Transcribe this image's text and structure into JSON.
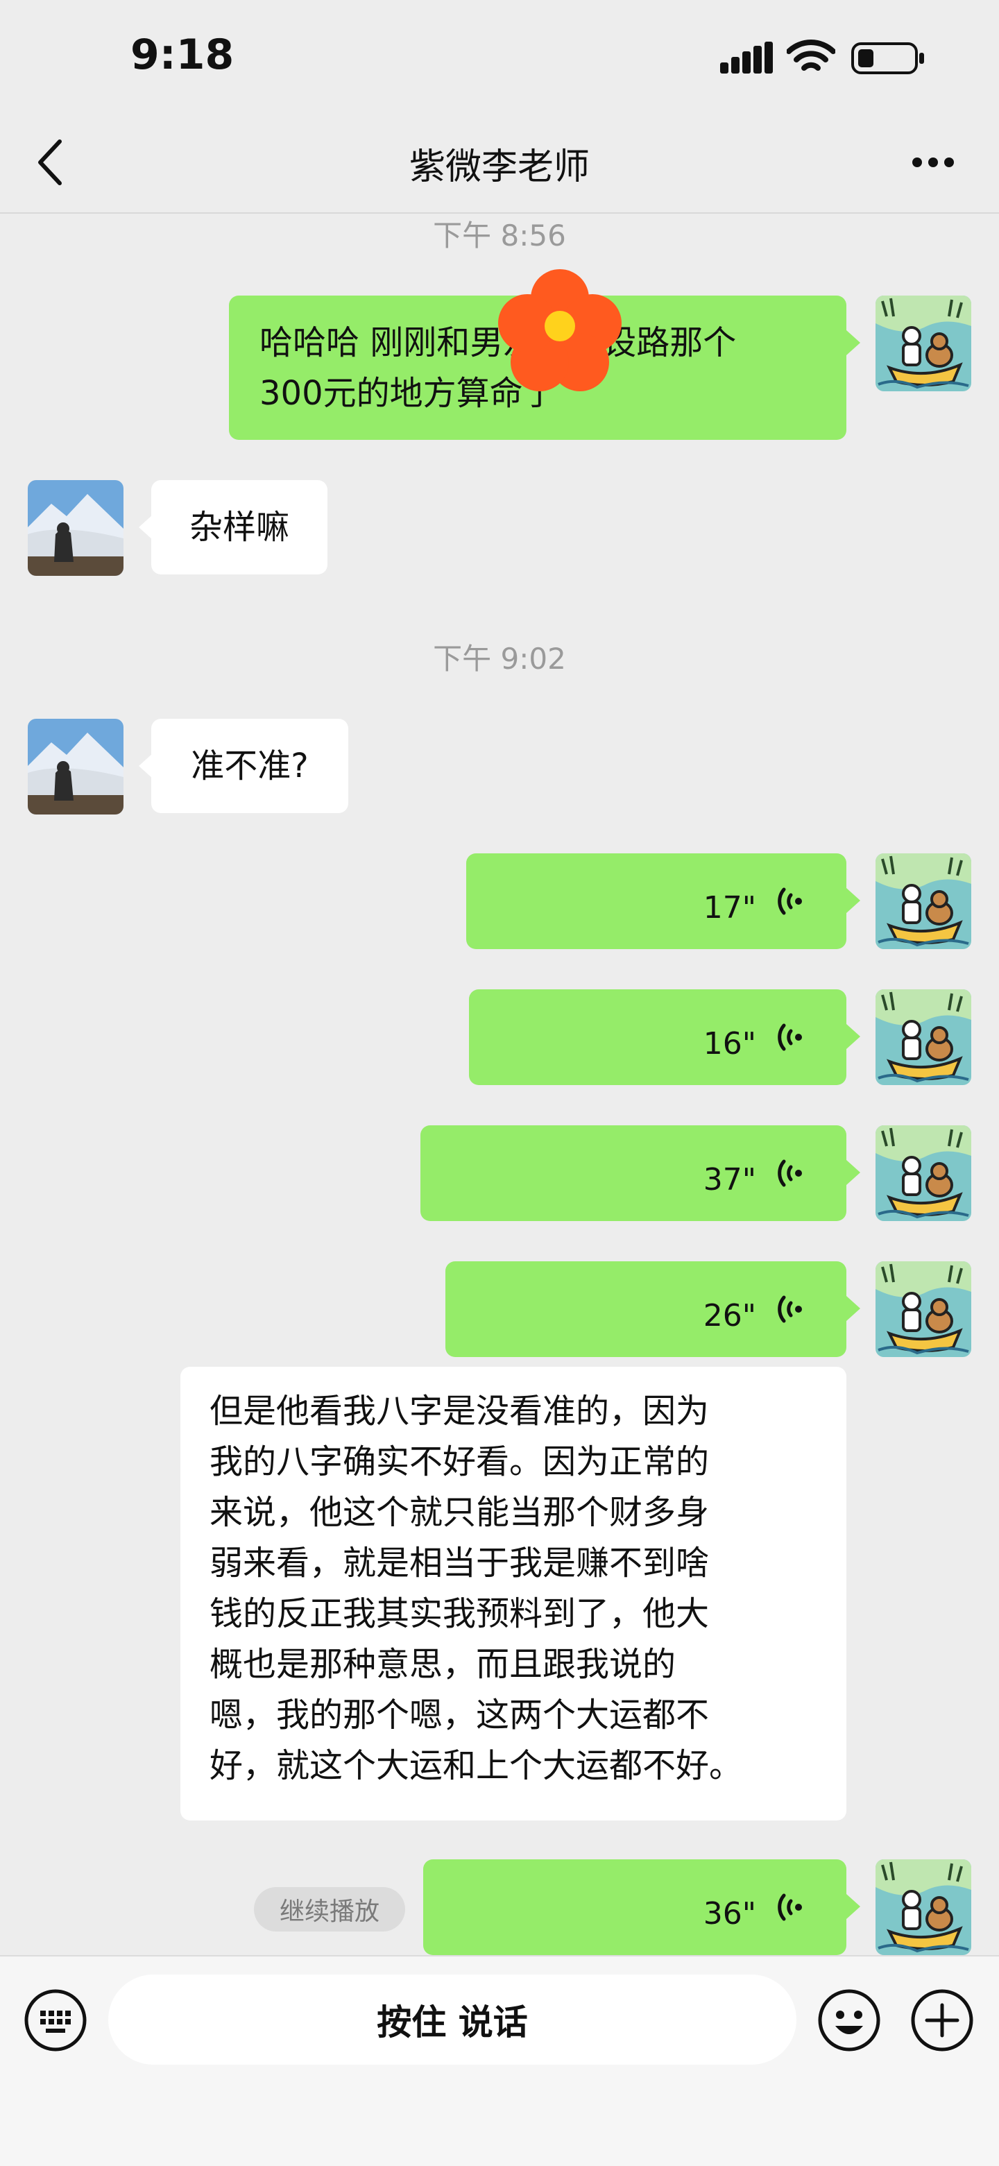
{
  "status_bar": {
    "time": "9:18"
  },
  "header": {
    "title": "紫微李老师"
  },
  "messages": {
    "t1": "下午 8:56",
    "m1": "哈哈哈 刚刚和男友去建设路那个300元的地方算命了",
    "m1_line1": "哈哈哈 刚刚和男友去建设路那个",
    "m1_line2": "300元的地方算命了",
    "m2": "杂样嘛",
    "t2": "下午 9:02",
    "m3": "准不准?",
    "v1": "17\"",
    "v2": "16\"",
    "v3": "37\"",
    "v4": "26\"",
    "transcript_lines": [
      "但是他看我八字是没看准的，因为",
      "我的八字确实不好看。因为正常的",
      "来说，他这个就只能当那个财多身",
      "弱来看，就是相当于我是赚不到啥",
      "钱的反正我其实我预料到了，他大",
      "概也是那种意思，而且跟我说的",
      "嗯，我的那个嗯，这两个大运都不",
      "好，就这个大运和上个大运都不好。"
    ],
    "v5": "36\"",
    "continue_label": "继续播放"
  },
  "input_bar": {
    "talk_label": "按住 说话"
  },
  "colors": {
    "sent_bubble": "#95ec69",
    "received_bubble": "#ffffff",
    "background": "#ededed",
    "sticker": "#ff5a1f"
  },
  "icons": [
    "back-icon",
    "more-icon",
    "voice-wave-icon",
    "keyboard-icon",
    "emoji-icon",
    "plus-icon",
    "signal-icon",
    "wifi-icon",
    "battery-icon",
    "flower-sticker"
  ]
}
